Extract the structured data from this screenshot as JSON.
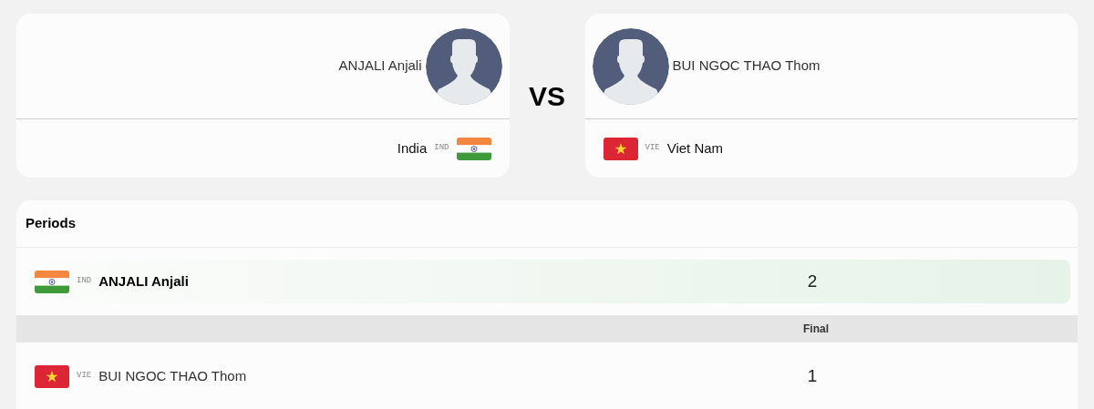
{
  "competitors": [
    {
      "name": "ANJALI Anjali",
      "country": "India",
      "code": "IND",
      "flag": {
        "kind": "india"
      }
    },
    {
      "name": "BUI NGOC THAO Thom",
      "country": "Viet Nam",
      "code": "VIE",
      "flag": {
        "kind": "vietnam"
      }
    }
  ],
  "versus": "VS",
  "periods": {
    "title": "Periods",
    "column": "Final",
    "rows": [
      {
        "code": "IND",
        "flag": {
          "kind": "india"
        },
        "name": "ANJALI Anjali",
        "score": "2",
        "winner": true
      },
      {
        "code": "VIE",
        "flag": {
          "kind": "vietnam"
        },
        "name": "BUI NGOC THAO Thom",
        "score": "1",
        "winner": false
      }
    ]
  }
}
